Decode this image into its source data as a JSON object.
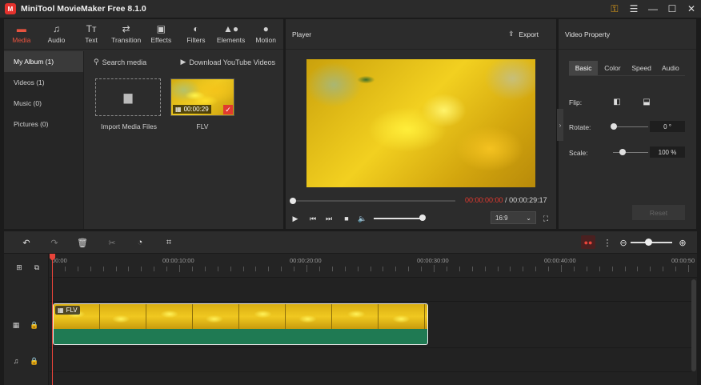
{
  "window": {
    "title": "MiniTool MovieMaker Free 8.1.0",
    "logo_glyph": "M",
    "controls": [
      "key-icon",
      "menu-icon",
      "minimize-icon",
      "maximize-icon",
      "close-icon"
    ]
  },
  "tabs": [
    {
      "label": "Media",
      "icon": "folder-icon",
      "glyph": "▬",
      "active": true
    },
    {
      "label": "Audio",
      "icon": "music-icon",
      "glyph": "♫"
    },
    {
      "label": "Text",
      "icon": "text-icon",
      "glyph": "Tт"
    },
    {
      "label": "Transition",
      "icon": "transition-icon",
      "glyph": "⇄"
    },
    {
      "label": "Effects",
      "icon": "effects-icon",
      "glyph": "▣"
    },
    {
      "label": "Filters",
      "icon": "filters-icon",
      "glyph": "◐"
    },
    {
      "label": "Elements",
      "icon": "elements-icon",
      "glyph": "▲●"
    },
    {
      "label": "Motion",
      "icon": "motion-icon",
      "glyph": "●"
    }
  ],
  "media": {
    "sidebar": [
      {
        "label": "My Album (1)",
        "active": true
      },
      {
        "label": "Videos (1)"
      },
      {
        "label": "Music (0)"
      },
      {
        "label": "Pictures (0)"
      }
    ],
    "search_label": "Search media",
    "youtube_label": "Download YouTube Videos",
    "import_label": "Import Media Files",
    "item": {
      "name": "FLV",
      "duration": "00:00:29"
    }
  },
  "player": {
    "title": "Player",
    "export_label": "Export",
    "current_time": "00:00:00:00",
    "separator": " / ",
    "total_time": "00:00:29:17",
    "aspect_ratio": "16:9",
    "progress": 0,
    "volume": 1.0
  },
  "property": {
    "title": "Video Property",
    "tabs": [
      {
        "label": "Basic",
        "active": true
      },
      {
        "label": "Color"
      },
      {
        "label": "Speed"
      },
      {
        "label": "Audio"
      }
    ],
    "flip_label": "Flip:",
    "rotate_label": "Rotate:",
    "rotate_value": "0 °",
    "scale_label": "Scale:",
    "scale_value": "100 %",
    "reset_label": "Reset"
  },
  "timeline": {
    "ruler_labels": [
      "00:00",
      "00:00:10:00",
      "00:00:20:00",
      "00:00:30:00",
      "00:00:40:00",
      "00:00:50"
    ],
    "clip_label": "FLV"
  },
  "colors": {
    "accent": "#e8443a",
    "panel": "#2c2c2c",
    "clip_audio": "#1f7a53"
  }
}
